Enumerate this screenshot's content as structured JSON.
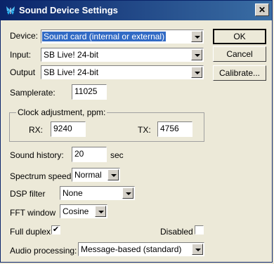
{
  "window": {
    "title": "Sound Device Settings",
    "close_label": "✕"
  },
  "device": {
    "label": "Device:",
    "value": "Sound card (internal or external)"
  },
  "input": {
    "label": "Input:",
    "value": "SB Live! 24-bit"
  },
  "output": {
    "label": "Output",
    "value": "SB Live! 24-bit"
  },
  "samplerate": {
    "label": "Samplerate:",
    "value": "11025"
  },
  "clock": {
    "legend": "Clock adjustment, ppm:",
    "rx_label": "RX:",
    "rx_value": "9240",
    "tx_label": "TX:",
    "tx_value": "4756"
  },
  "history": {
    "label": "Sound history:",
    "value": "20",
    "unit": "sec"
  },
  "spectrum": {
    "label": "Spectrum speed:",
    "value": "Normal"
  },
  "dsp": {
    "label": "DSP filter",
    "value": "None"
  },
  "fft": {
    "label": "FFT window",
    "value": "Cosine"
  },
  "full_duplex": {
    "label": "Full duplex",
    "checked": true,
    "mark": "✔"
  },
  "disabled": {
    "label": "Disabled",
    "checked": false
  },
  "audio": {
    "label": "Audio processing:",
    "value": "Message-based (standard)"
  },
  "buttons": {
    "ok": "OK",
    "cancel": "Cancel",
    "calibrate": "Calibrate..."
  }
}
